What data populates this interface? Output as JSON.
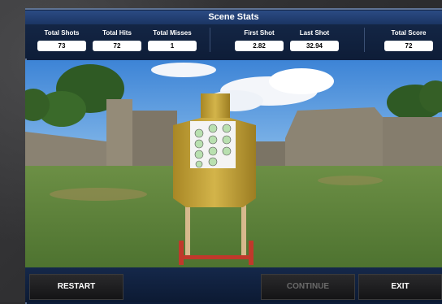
{
  "header": {
    "title": "Scene Stats"
  },
  "stats": [
    {
      "label": "Total Shots",
      "value": "73"
    },
    {
      "label": "Total Hits",
      "value": "72"
    },
    {
      "label": "Total Misses",
      "value": "1"
    },
    {
      "label": "First Shot",
      "value": "2.82"
    },
    {
      "label": "Last Shot",
      "value": "32.94"
    },
    {
      "label": "Total Score",
      "value": "72"
    }
  ],
  "buttons": {
    "restart": "RESTART",
    "continue": "CONTINUE",
    "exit": "EXIT"
  },
  "colors": {
    "title_bar": "#2b4b84",
    "panel_bg": "#0d1d3a",
    "target_gold": "#c9a93b",
    "stand_red": "#c0392b"
  }
}
